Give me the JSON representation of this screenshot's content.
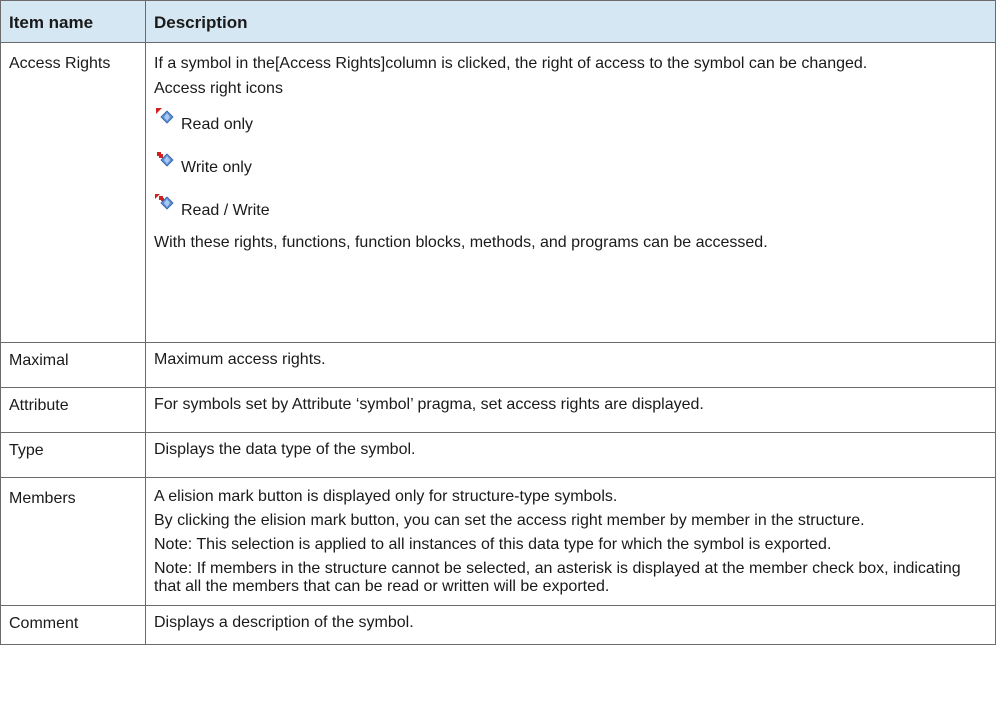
{
  "table": {
    "headers": {
      "item_name": "Item name",
      "description": "Description"
    },
    "access_rights": {
      "name": "Access Rights",
      "intro": "If a symbol in the[Access Rights]column is clicked, the right of access to the symbol can be changed.",
      "icons_heading": "Access right icons",
      "icons": [
        {
          "icon": "read-only-icon",
          "label": "Read only"
        },
        {
          "icon": "write-only-icon",
          "label": "Write only"
        },
        {
          "icon": "read-write-icon",
          "label": "Read / Write"
        }
      ],
      "note": "With these rights, functions, function blocks, methods, and programs can be accessed."
    },
    "maximal": {
      "name": "Maximal",
      "desc": "Maximum access rights."
    },
    "attribute": {
      "name": "Attribute",
      "desc": "For symbols set by Attribute ‘symbol’ pragma, set access rights are displayed."
    },
    "type": {
      "name": "Type",
      "desc": "Displays the data type of the symbol."
    },
    "members": {
      "name": "Members",
      "paragraphs": [
        "A elision mark button is displayed only for structure-type symbols.",
        "By clicking the elision mark button, you can set the access right member by member in the structure.",
        "Note: This selection is applied to all instances of this data type for which the symbol is exported.",
        "Note: If members in the structure cannot be selected, an asterisk is displayed at the member check box, indicating that all the members that can be read or written will be exported."
      ]
    },
    "comment": {
      "name": "Comment",
      "desc": "Displays a description of the symbol."
    }
  }
}
